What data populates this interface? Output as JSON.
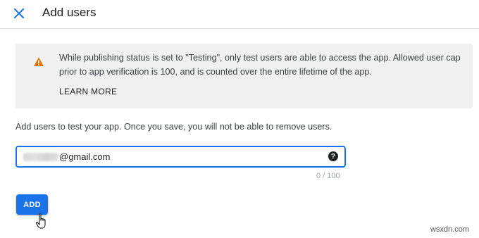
{
  "header": {
    "title": "Add users",
    "close_icon": "close-icon"
  },
  "banner": {
    "icon": "warning-icon",
    "warning_color": "#e37400",
    "message": "While publishing status is set to \"Testing\", only test users are able to access the app. Allowed user cap prior to app verification is 100, and is counted over the entire lifetime of the app.",
    "learn_more_label": "LEARN MORE"
  },
  "form": {
    "instruction": "Add users to test your app. Once you save, you will not be able to remove users.",
    "email_value": "@gmail.com",
    "help_label": "?",
    "counter": "0 / 100",
    "add_label": "ADD"
  },
  "watermark": "wsxdn.com",
  "colors": {
    "accent": "#1a73e8",
    "banner_bg": "#f1f1f1"
  }
}
